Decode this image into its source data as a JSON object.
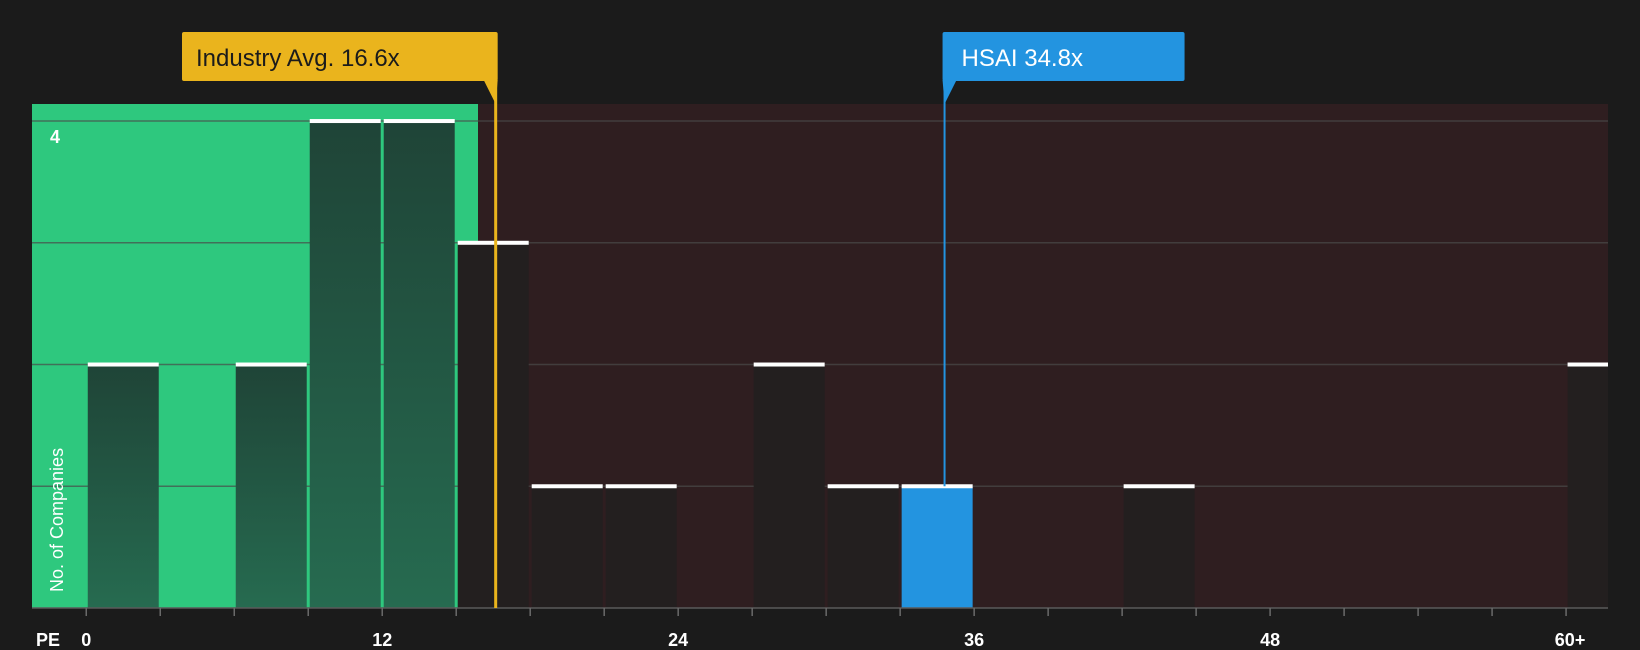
{
  "chart_data": {
    "type": "bar",
    "title": "",
    "xlabel": "PE",
    "ylabel": "No. of Companies",
    "y_tick_label": "4",
    "x_ticks": [
      "0",
      "12",
      "24",
      "36",
      "48",
      "60+"
    ],
    "xlim": [
      -2.2,
      61.7
    ],
    "ylim": [
      0,
      4.14
    ],
    "grid": true,
    "bin_width": 3,
    "bins": [
      {
        "start": 0,
        "count": 2
      },
      {
        "start": 6,
        "count": 2
      },
      {
        "start": 9,
        "count": 4
      },
      {
        "start": 12,
        "count": 4
      },
      {
        "start": 15,
        "count": 3
      },
      {
        "start": 18,
        "count": 1
      },
      {
        "start": 21,
        "count": 1
      },
      {
        "start": 27,
        "count": 2
      },
      {
        "start": 30,
        "count": 1
      },
      {
        "start": 33,
        "count": 1,
        "highlight": true
      },
      {
        "start": 42,
        "count": 1
      },
      {
        "start": 60,
        "count": 2
      }
    ],
    "industry_avg": {
      "label": "Industry Avg. 16.6x",
      "value": 16.6
    },
    "company": {
      "label": "HSAI 34.8x",
      "ticker": "HSAI",
      "value": 34.8
    }
  },
  "colors": {
    "background": "#1b1b1b",
    "below_avg_region": "#2ec87e",
    "above_avg_region": "#2f1e20",
    "bar_green_region": "#21463a",
    "bar_red_region": "#231f1f",
    "bar_highlight": "#2394e0",
    "bar_cap": "#ffffff",
    "industry_callout": "#eab41d",
    "company_callout": "#2394e0",
    "grid": "#4a4a4a"
  }
}
